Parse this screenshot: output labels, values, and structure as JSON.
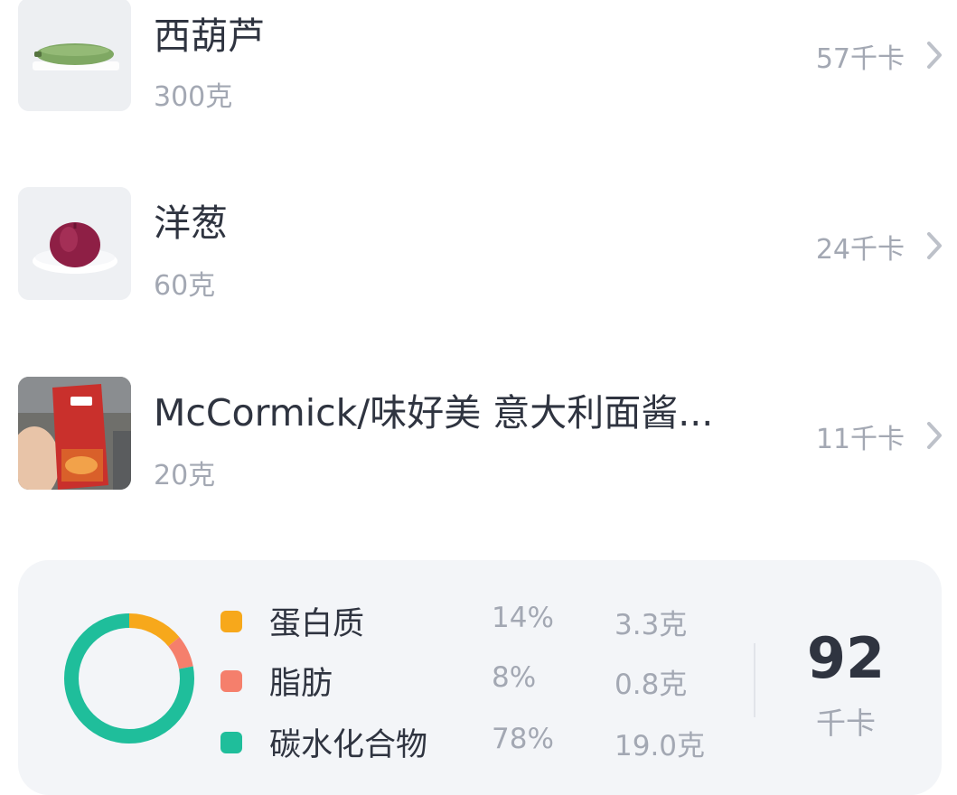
{
  "foods": [
    {
      "name": "西葫芦",
      "weight": "300克",
      "kcal": "57千卡",
      "image": "zucchini"
    },
    {
      "name": "洋葱",
      "weight": "60克",
      "kcal": "24千卡",
      "image": "onion"
    },
    {
      "name": "McCormick/味好美 意大利面酱...",
      "weight": "20克",
      "kcal": "11千卡",
      "image": "pasta-sauce-packet"
    }
  ],
  "summary": {
    "macros": [
      {
        "name": "蛋白质",
        "percent": "14%",
        "grams": "3.3克",
        "color": "#f7a81b",
        "fraction": 0.14
      },
      {
        "name": "脂肪",
        "percent": "8%",
        "grams": "0.8克",
        "color": "#f57f6c",
        "fraction": 0.08
      },
      {
        "name": "碳水化合物",
        "percent": "78%",
        "grams": "19.0克",
        "color": "#1fbe9b",
        "fraction": 0.78
      }
    ],
    "total_kcal": "92",
    "total_unit": "千卡"
  }
}
